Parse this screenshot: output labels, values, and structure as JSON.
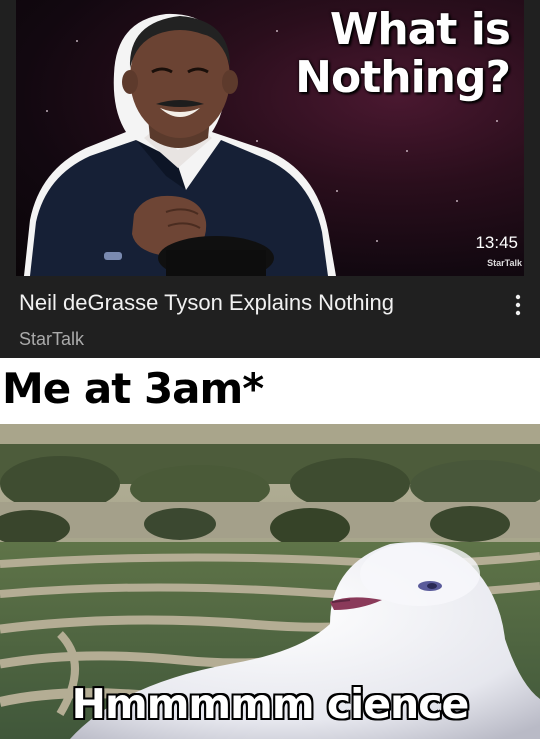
{
  "video": {
    "thumbnail_title_line1": "What is",
    "thumbnail_title_line2": "Nothing?",
    "duration": "13:45",
    "watermark": "StarTalk",
    "title": "Neil deGrasse Tyson Explains Nothing",
    "channel": "StarTalk",
    "more_icon": "more-vertical-icon"
  },
  "meme": {
    "top_caption": "Me at 3am*",
    "bottom_caption": "Hmmmmm cience"
  },
  "colors": {
    "card_background": "#202020",
    "title_text": "#f1f1f1",
    "channel_text": "#aaaaaa",
    "caption_band": "#ffffff"
  }
}
